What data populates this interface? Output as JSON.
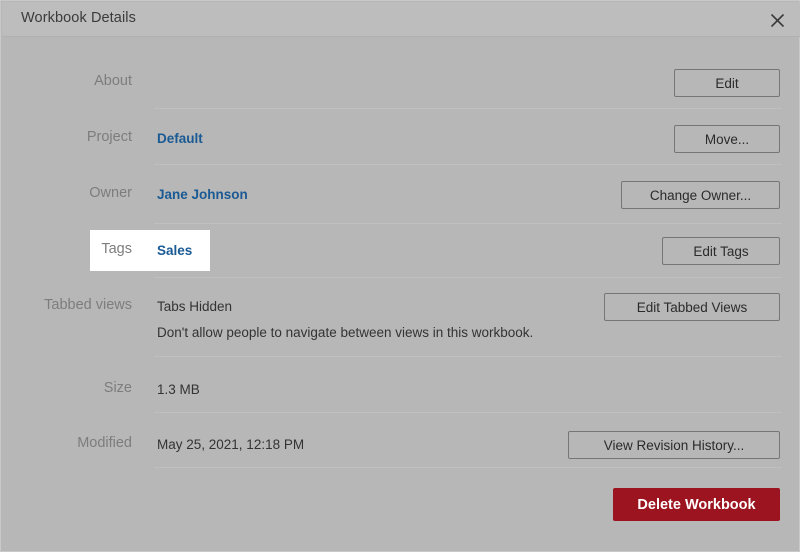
{
  "dialog": {
    "title": "Workbook Details",
    "close_icon": "close-icon"
  },
  "rows": {
    "about": {
      "label": "About",
      "button": "Edit"
    },
    "project": {
      "label": "Project",
      "value": "Default",
      "button": "Move..."
    },
    "owner": {
      "label": "Owner",
      "value": "Jane Johnson",
      "button": "Change Owner..."
    },
    "tags": {
      "label": "Tags",
      "value": "Sales",
      "button": "Edit Tags"
    },
    "tabbed_views": {
      "label": "Tabbed views",
      "value": "Tabs Hidden",
      "description": "Don't allow people to navigate between views in this workbook.",
      "button": "Edit Tabbed Views"
    },
    "size": {
      "label": "Size",
      "value": "1.3 MB"
    },
    "modified": {
      "label": "Modified",
      "value": "May 25, 2021, 12:18 PM",
      "button": "View Revision History..."
    }
  },
  "footer": {
    "delete_button": "Delete Workbook"
  },
  "colors": {
    "dialog_background": "#b7b7b7",
    "titlebar_background": "#bdbdbd",
    "label_text": "#7d7d7d",
    "value_text": "#333333",
    "link_text": "#1a5a94",
    "button_border": "#767676",
    "danger_background": "#9c1420",
    "divider": "#c0c0c0",
    "highlight_background": "#ffffff"
  }
}
